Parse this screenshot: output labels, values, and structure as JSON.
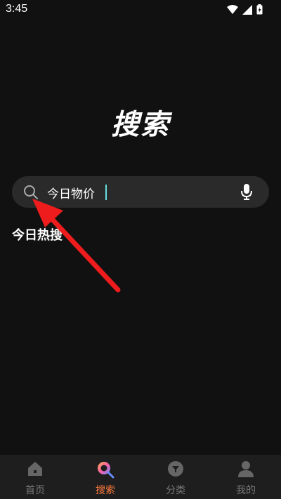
{
  "status_bar": {
    "time": "3:45"
  },
  "page": {
    "title": "搜索"
  },
  "search": {
    "value": "今日物价"
  },
  "hot": {
    "title": "今日热搜"
  },
  "tabs": [
    {
      "label": "首页",
      "icon": "home-icon",
      "active": false
    },
    {
      "label": "搜索",
      "icon": "search-tab-icon",
      "active": true
    },
    {
      "label": "分类",
      "icon": "category-icon",
      "active": false
    },
    {
      "label": "我的",
      "icon": "profile-icon",
      "active": false
    }
  ],
  "colors": {
    "background": "#111111",
    "search_bg": "#2a2a2a",
    "accent_active": "#ff7a3d",
    "annotation_arrow": "#ee1c1c"
  }
}
